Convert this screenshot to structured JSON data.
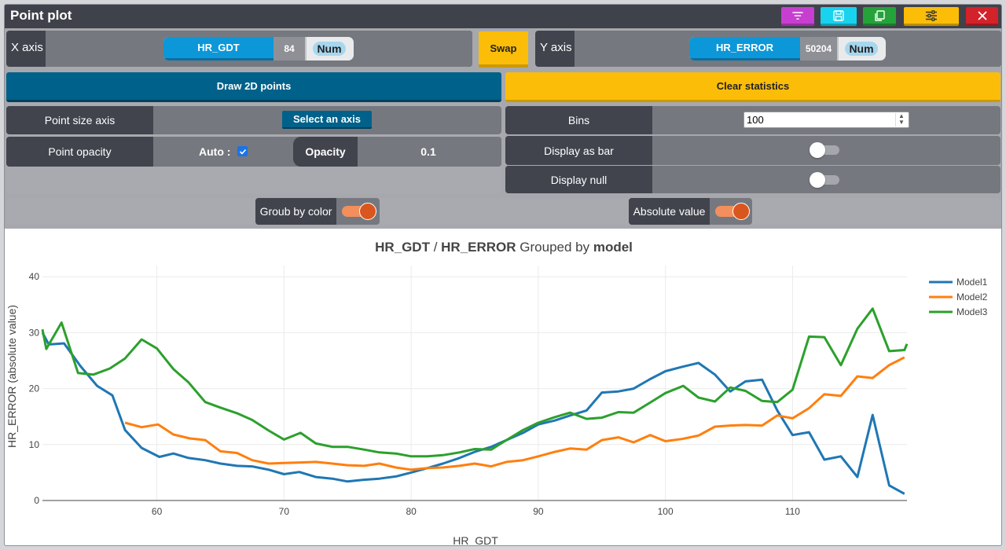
{
  "window": {
    "title": "Point plot"
  },
  "toolbar": {
    "buttons": [
      {
        "name": "filter-button",
        "icon": "filter-icon",
        "color": "#c73fd1"
      },
      {
        "name": "save-button",
        "icon": "save-icon",
        "color": "#19d2ee"
      },
      {
        "name": "copy-button",
        "icon": "copy-icon",
        "color": "#25a33a"
      },
      {
        "name": "settings-button",
        "icon": "sliders-icon",
        "color": "#fbbd08"
      },
      {
        "name": "close-button",
        "icon": "close-icon",
        "color": "#d3222a"
      }
    ]
  },
  "x_axis": {
    "label": "X axis",
    "field": "HR_GDT",
    "count": "84",
    "type": "Num"
  },
  "y_axis": {
    "label": "Y axis",
    "field": "HR_ERROR",
    "count": "50204",
    "type": "Num"
  },
  "swap_label": "Swap",
  "left_panel": {
    "draw_label": "Draw 2D points",
    "point_size_label": "Point size axis",
    "select_axis_label": "Select an axis",
    "opacity_row_label": "Point opacity",
    "auto_label": "Auto :",
    "auto_checked": true,
    "opacity_label": "Opacity",
    "opacity_value": "0.1"
  },
  "right_panel": {
    "clear_label": "Clear statistics",
    "bins_label": "Bins",
    "bins_value": "100",
    "bar_label": "Display as bar",
    "bar_on": false,
    "null_label": "Display null",
    "null_on": false
  },
  "options": {
    "group_label": "Groub by color",
    "group_on": true,
    "abs_label": "Absolute value",
    "abs_on": true
  },
  "chart_data": {
    "type": "line",
    "title_parts": {
      "x": "HR_GDT",
      "sep": " / ",
      "y": "HR_ERROR",
      "mid": " Grouped by ",
      "group": "model"
    },
    "xlabel": "HR_GDT",
    "ylabel": "HR_ERROR (absolute value)",
    "xlim": [
      51,
      119
    ],
    "ylim": [
      0,
      42
    ],
    "xticks": [
      60,
      70,
      80,
      90,
      100,
      110
    ],
    "yticks": [
      0,
      10,
      20,
      30,
      40
    ],
    "grid": true,
    "legend": "top-right",
    "series": [
      {
        "name": "Model1",
        "color": "#1f77b4",
        "points": [
          [
            51,
            30
          ],
          [
            51.5,
            27.9
          ],
          [
            52.7,
            28.1
          ],
          [
            54,
            24
          ],
          [
            55.3,
            20.5
          ],
          [
            56.5,
            18.8
          ],
          [
            57.5,
            12.6
          ],
          [
            58.8,
            9.4
          ],
          [
            60.2,
            7.8
          ],
          [
            61.3,
            8.4
          ],
          [
            62.5,
            7.6
          ],
          [
            63.8,
            7.2
          ],
          [
            65,
            6.6
          ],
          [
            66.3,
            6.2
          ],
          [
            67.5,
            6.1
          ],
          [
            68.8,
            5.5
          ],
          [
            70,
            4.7
          ],
          [
            71.2,
            5.1
          ],
          [
            72.5,
            4.2
          ],
          [
            73.8,
            3.9
          ],
          [
            75,
            3.4
          ],
          [
            76.2,
            3.7
          ],
          [
            77.5,
            3.9
          ],
          [
            78.8,
            4.3
          ],
          [
            80,
            5.0
          ],
          [
            81.3,
            5.8
          ],
          [
            82.5,
            6.6
          ],
          [
            83.8,
            7.6
          ],
          [
            85,
            8.7
          ],
          [
            86.3,
            9.6
          ],
          [
            87.5,
            10.8
          ],
          [
            88.8,
            12.1
          ],
          [
            90,
            13.6
          ],
          [
            91.3,
            14.3
          ],
          [
            92.5,
            15.2
          ],
          [
            93.8,
            16.1
          ],
          [
            95,
            19.3
          ],
          [
            96.3,
            19.5
          ],
          [
            97.5,
            20
          ],
          [
            98.8,
            21.7
          ],
          [
            100,
            23.1
          ],
          [
            101.3,
            23.9
          ],
          [
            102.6,
            24.6
          ],
          [
            103.9,
            22.5
          ],
          [
            105.1,
            19.5
          ],
          [
            106.3,
            21.3
          ],
          [
            107.6,
            21.6
          ],
          [
            108.8,
            16.1
          ],
          [
            110,
            11.7
          ],
          [
            111.3,
            12.2
          ],
          [
            112.5,
            7.3
          ],
          [
            113.8,
            7.9
          ],
          [
            115.1,
            4.2
          ],
          [
            116.3,
            15.3
          ],
          [
            117.6,
            2.7
          ],
          [
            118.8,
            1.2
          ]
        ]
      },
      {
        "name": "Model2",
        "color": "#ff7f0e",
        "points": [
          [
            57.5,
            13.9
          ],
          [
            58.8,
            13.1
          ],
          [
            60.1,
            13.6
          ],
          [
            61.3,
            11.8
          ],
          [
            62.6,
            11.1
          ],
          [
            63.8,
            10.8
          ],
          [
            65,
            8.8
          ],
          [
            66.3,
            8.5
          ],
          [
            67.5,
            7.2
          ],
          [
            68.8,
            6.6
          ],
          [
            70,
            6.7
          ],
          [
            71.3,
            6.8
          ],
          [
            72.5,
            6.9
          ],
          [
            73.8,
            6.6
          ],
          [
            75,
            6.3
          ],
          [
            76.3,
            6.2
          ],
          [
            77.5,
            6.6
          ],
          [
            78.8,
            5.9
          ],
          [
            80,
            5.5
          ],
          [
            81.3,
            5.8
          ],
          [
            82.5,
            5.9
          ],
          [
            83.8,
            6.2
          ],
          [
            85,
            6.6
          ],
          [
            86.3,
            6.1
          ],
          [
            87.5,
            6.9
          ],
          [
            88.8,
            7.2
          ],
          [
            90,
            7.9
          ],
          [
            91.3,
            8.7
          ],
          [
            92.5,
            9.3
          ],
          [
            93.8,
            9.1
          ],
          [
            95,
            10.8
          ],
          [
            96.3,
            11.3
          ],
          [
            97.5,
            10.4
          ],
          [
            98.8,
            11.7
          ],
          [
            100,
            10.6
          ],
          [
            101.3,
            11
          ],
          [
            102.6,
            11.6
          ],
          [
            103.9,
            13.2
          ],
          [
            105.1,
            13.4
          ],
          [
            106.3,
            13.5
          ],
          [
            107.6,
            13.4
          ],
          [
            108.8,
            15.2
          ],
          [
            110,
            14.7
          ],
          [
            111.3,
            16.5
          ],
          [
            112.5,
            19
          ],
          [
            113.8,
            18.7
          ],
          [
            115.1,
            22.2
          ],
          [
            116.3,
            21.9
          ],
          [
            117.6,
            24.2
          ],
          [
            118.8,
            25.6
          ]
        ]
      },
      {
        "name": "Model3",
        "color": "#2ca02c",
        "points": [
          [
            51,
            30.6
          ],
          [
            51.3,
            27.1
          ],
          [
            52.5,
            31.8
          ],
          [
            53.8,
            22.8
          ],
          [
            55,
            22.5
          ],
          [
            56.3,
            23.6
          ],
          [
            57.5,
            25.4
          ],
          [
            58.8,
            28.8
          ],
          [
            60,
            27.2
          ],
          [
            61.3,
            23.5
          ],
          [
            62.5,
            21.1
          ],
          [
            63.8,
            17.6
          ],
          [
            65,
            16.6
          ],
          [
            66.3,
            15.6
          ],
          [
            67.5,
            14.4
          ],
          [
            68.8,
            12.5
          ],
          [
            70,
            10.9
          ],
          [
            71.3,
            12.1
          ],
          [
            72.5,
            10.2
          ],
          [
            73.8,
            9.6
          ],
          [
            75,
            9.6
          ],
          [
            76.3,
            9.1
          ],
          [
            77.5,
            8.6
          ],
          [
            78.8,
            8.4
          ],
          [
            80,
            7.9
          ],
          [
            81.3,
            7.9
          ],
          [
            82.5,
            8.1
          ],
          [
            83.8,
            8.6
          ],
          [
            85,
            9.2
          ],
          [
            86.3,
            9.1
          ],
          [
            87.5,
            10.8
          ],
          [
            88.8,
            12.6
          ],
          [
            90,
            13.9
          ],
          [
            91.3,
            14.9
          ],
          [
            92.5,
            15.7
          ],
          [
            93.8,
            14.6
          ],
          [
            95,
            14.8
          ],
          [
            96.3,
            15.8
          ],
          [
            97.5,
            15.7
          ],
          [
            98.8,
            17.5
          ],
          [
            100,
            19.2
          ],
          [
            101.4,
            20.5
          ],
          [
            102.6,
            18.4
          ],
          [
            103.9,
            17.7
          ],
          [
            105.1,
            20.2
          ],
          [
            106.3,
            19.6
          ],
          [
            107.6,
            17.8
          ],
          [
            108.8,
            17.6
          ],
          [
            110,
            19.8
          ],
          [
            111.3,
            29.3
          ],
          [
            112.5,
            29.2
          ],
          [
            113.8,
            24.2
          ],
          [
            115.1,
            30.7
          ],
          [
            116.3,
            34.3
          ],
          [
            117.6,
            26.7
          ],
          [
            118.8,
            26.9
          ],
          [
            119,
            28
          ]
        ]
      }
    ]
  }
}
